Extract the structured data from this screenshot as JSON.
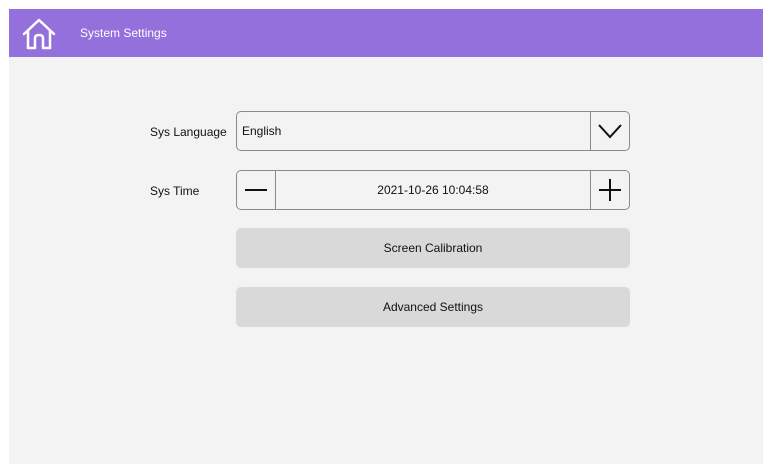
{
  "header": {
    "title": "System Settings",
    "home_icon": "home-icon",
    "background_color": "#9370db"
  },
  "settings": {
    "language": {
      "label": "Sys Language",
      "value": "English",
      "dropdown_icon": "chevron-down-icon"
    },
    "time": {
      "label": "Sys Time",
      "value": "2021-10-26 10:04:58",
      "decrement_icon": "minus-icon",
      "increment_icon": "plus-icon"
    }
  },
  "buttons": {
    "screen_calibration": "Screen Calibration",
    "advanced_settings": "Advanced Settings"
  }
}
